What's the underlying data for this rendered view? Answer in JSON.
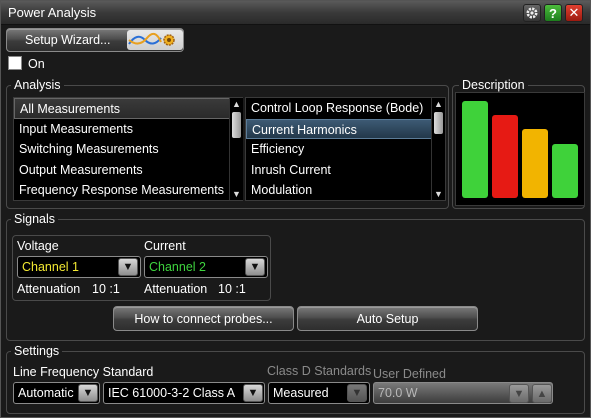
{
  "window": {
    "title": "Power Analysis"
  },
  "toolbar": {
    "wizard_label": "Setup Wizard..."
  },
  "on_toggle": {
    "label": "On",
    "checked": false
  },
  "analysis": {
    "group_label": "Analysis",
    "categories": [
      "All Measurements",
      "Input Measurements",
      "Switching Measurements",
      "Output Measurements",
      "Frequency Response Measurements"
    ],
    "selected_category": "All Measurements",
    "measurements": [
      "Control Loop Response (Bode)",
      "Current Harmonics",
      "Efficiency",
      "Inrush Current",
      "Modulation"
    ],
    "selected_measurement": "Current Harmonics"
  },
  "description": {
    "label": "Description",
    "bars": [
      {
        "level": 0.93,
        "color": "#3fd23a"
      },
      {
        "level": 0.8,
        "color": "#e61a14"
      },
      {
        "level": 0.66,
        "color": "#f2b400"
      },
      {
        "level": 0.52,
        "color": "#3fd23a"
      }
    ]
  },
  "signals": {
    "group_label": "Signals",
    "voltage": {
      "label": "Voltage",
      "channel": "Channel 1",
      "channel_color": "#f2e832",
      "attenuation_label": "Attenuation",
      "attenuation_value": "10 :1"
    },
    "current": {
      "label": "Current",
      "channel": "Channel 2",
      "channel_color": "#3ed33e",
      "attenuation_label": "Attenuation",
      "attenuation_value": "10 :1"
    },
    "connect_button": "How to connect probes...",
    "auto_setup_button": "Auto Setup"
  },
  "settings": {
    "group_label": "Settings",
    "line_freq_label": "Line Frequency Standard",
    "line_freq_value": "Automatic",
    "standard_value": "IEC 61000-3-2 Class A",
    "class_d_label": "Class D Standards",
    "class_d_value": "Measured",
    "user_defined_label": "User Defined",
    "user_defined_value": "70.0 W"
  }
}
